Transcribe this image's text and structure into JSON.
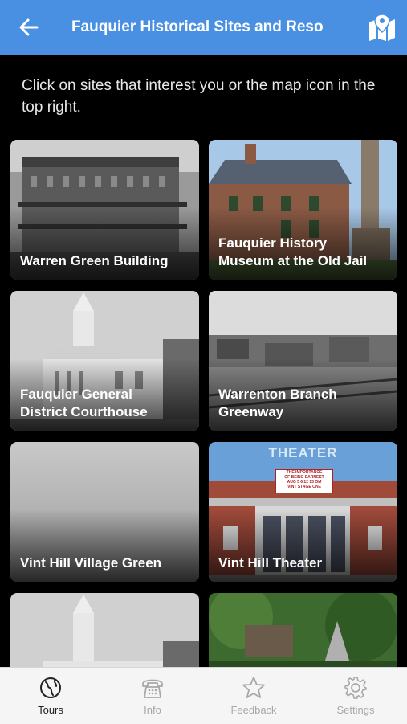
{
  "header": {
    "title": "Fauquier Historical Sites and Reso",
    "back_icon": "arrow-left-icon",
    "map_icon": "map-pin-icon",
    "color": "#4a90e2"
  },
  "intro": "Click on sites that interest you or the map icon in the top right.",
  "sites": [
    {
      "name": "Warren Green Building"
    },
    {
      "name": "Fauquier History\nMuseum at the Old Jail"
    },
    {
      "name": "Fauquier General\nDistrict Courthouse"
    },
    {
      "name": "Warrenton Branch\nGreenway"
    },
    {
      "name": "Vint Hill Village Green"
    },
    {
      "name": "Vint Hill Theater",
      "sign_title": "THEATER",
      "sign_text": "THE IMPORTANCE\nOF BEING EARNEST\nAUG 5 6 12 13 OM\nVINT STAGE ONE"
    },
    {
      "name": ""
    },
    {
      "name": ""
    }
  ],
  "tabs": [
    {
      "label": "Tours",
      "icon": "globe-icon",
      "active": true
    },
    {
      "label": "Info",
      "icon": "phone-icon",
      "active": false
    },
    {
      "label": "Feedback",
      "icon": "star-icon",
      "active": false
    },
    {
      "label": "Settings",
      "icon": "gear-icon",
      "active": false
    }
  ]
}
